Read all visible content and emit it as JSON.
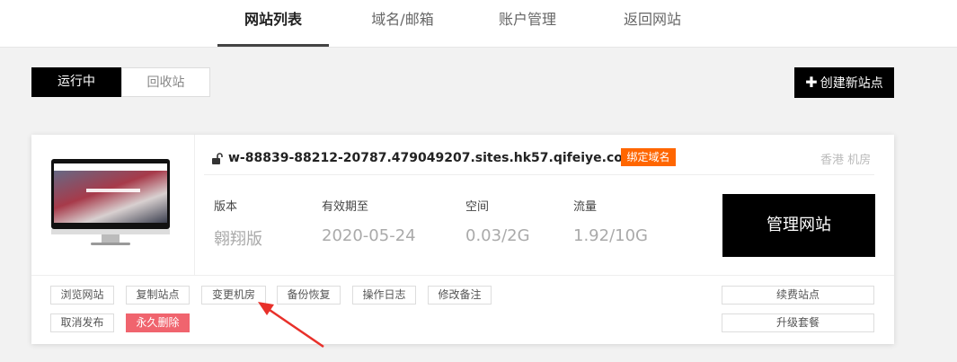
{
  "nav": {
    "tabs": [
      {
        "label": "网站列表",
        "active": true
      },
      {
        "label": "域名/邮箱",
        "active": false
      },
      {
        "label": "账户管理",
        "active": false
      },
      {
        "label": "返回网站",
        "active": false
      }
    ]
  },
  "status_toggle": {
    "running": "运行中",
    "recycle": "回收站"
  },
  "create_button": {
    "icon": "plus-icon",
    "label": "创建新站点"
  },
  "site": {
    "url": "w-88839-88212-20787.479049207.sites.hk57.qifeiye.com",
    "bind_domain": "绑定域名",
    "location": "香港 机房",
    "stats": {
      "version_label": "版本",
      "version_value": "翱翔版",
      "expiry_label": "有效期至",
      "expiry_value": "2020-05-24",
      "space_label": "空间",
      "space_value": "0.03/2G",
      "traffic_label": "流量",
      "traffic_value": "1.92/10G"
    },
    "manage_button": "管理网站",
    "thumbnail_text": "SPORTING GOODS"
  },
  "actions": {
    "browse": "浏览网站",
    "copy": "复制站点",
    "change_room": "变更机房",
    "backup": "备份恢复",
    "log": "操作日志",
    "remark": "修改备注",
    "unpublish": "取消发布",
    "delete": "永久删除",
    "renew": "续费站点",
    "upgrade": "升级套餐"
  },
  "colors": {
    "accent_orange": "#ff6600",
    "danger": "#f0646e",
    "arrow": "#e8302a",
    "primary": "#000000"
  }
}
